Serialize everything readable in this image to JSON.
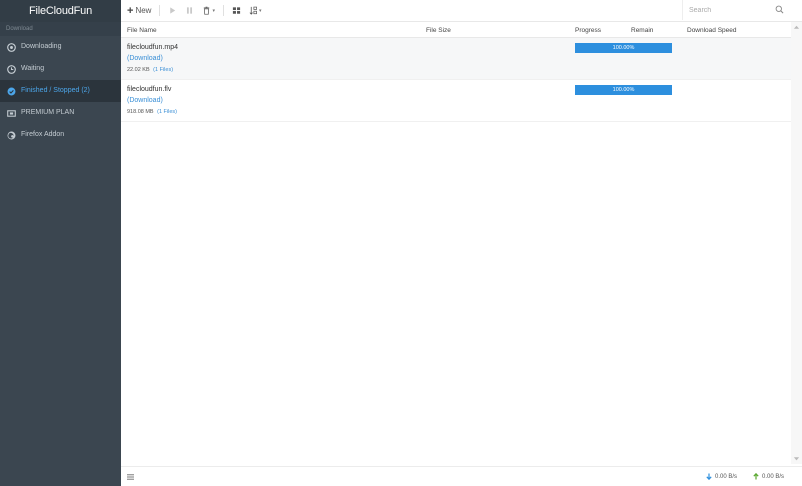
{
  "app": {
    "title": "FileCloudFun"
  },
  "sidebar": {
    "section_label": "Download",
    "items": [
      {
        "label": "Downloading",
        "icon": "play-circle-icon",
        "active": false
      },
      {
        "label": "Waiting",
        "icon": "clock-icon",
        "active": false
      },
      {
        "label": "Finished / Stopped (2)",
        "icon": "check-circle-icon",
        "active": true
      },
      {
        "label": "PREMIUM PLAN",
        "icon": "ticket-icon",
        "active": false
      },
      {
        "label": "Firefox Addon",
        "icon": "firefox-icon",
        "active": false
      }
    ]
  },
  "toolbar": {
    "new_label": "New",
    "buttons": [
      "start-icon",
      "pause-icon",
      "trash-icon",
      "grid-icon",
      "sort-icon"
    ]
  },
  "search": {
    "placeholder": "Search"
  },
  "table": {
    "columns": {
      "name": "File Name",
      "size": "File Size",
      "progress": "Progress",
      "remain": "Remain",
      "speed": "Download Speed"
    },
    "rows": [
      {
        "name": "filecloudfun.mp4",
        "link": "(Download)",
        "size": "22.02 KB",
        "files": "(1 Files)",
        "progress": 1.0,
        "progress_text": "100.00%"
      },
      {
        "name": "filecloudfun.flv",
        "link": "(Download)",
        "size": "918.08 MB",
        "files": "(1 Files)",
        "progress": 1.0,
        "progress_text": "100.00%"
      }
    ]
  },
  "status": {
    "download_speed": "0.00 B/s",
    "upload_speed": "0.00 B/s"
  },
  "colors": {
    "sidebar_bg": "#3b4650",
    "active_text": "#4ca6ea",
    "progress_fill": "#2d8fde",
    "link": "#3a8fd6"
  }
}
